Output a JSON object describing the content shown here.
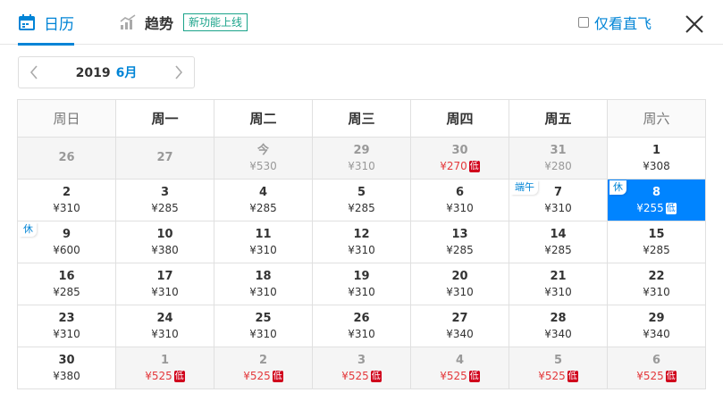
{
  "tabs": {
    "calendar": "日历",
    "trend": "趋势",
    "new_badge": "新功能上线"
  },
  "direct_only_label": "仅看直飞",
  "month_nav": {
    "year": "2019",
    "month": "6月"
  },
  "weekdays": [
    "周日",
    "周一",
    "周二",
    "周三",
    "周四",
    "周五",
    "周六"
  ],
  "low_tag": "低",
  "colors": {
    "accent": "#0084d6",
    "selected": "#0084ff",
    "low_price": "#e4393c",
    "new_badge": "#1aa38a"
  },
  "weeks": [
    [
      {
        "day": "26",
        "price": "",
        "other": true
      },
      {
        "day": "27",
        "price": "",
        "other": true
      },
      {
        "day": "今",
        "price": "¥530",
        "other": true
      },
      {
        "day": "29",
        "price": "¥310",
        "other": true
      },
      {
        "day": "30",
        "price": "¥270",
        "other": true,
        "low": true
      },
      {
        "day": "31",
        "price": "¥280",
        "other": true
      },
      {
        "day": "1",
        "price": "¥308"
      }
    ],
    [
      {
        "day": "2",
        "price": "¥310"
      },
      {
        "day": "3",
        "price": "¥285"
      },
      {
        "day": "4",
        "price": "¥285"
      },
      {
        "day": "5",
        "price": "¥285"
      },
      {
        "day": "6",
        "price": "¥310"
      },
      {
        "day": "7",
        "price": "¥310",
        "holiday": "端午"
      },
      {
        "day": "8",
        "price": "¥255",
        "holiday": "休",
        "low": true,
        "selected": true
      }
    ],
    [
      {
        "day": "9",
        "price": "¥600",
        "holiday": "休"
      },
      {
        "day": "10",
        "price": "¥380"
      },
      {
        "day": "11",
        "price": "¥310"
      },
      {
        "day": "12",
        "price": "¥310"
      },
      {
        "day": "13",
        "price": "¥285"
      },
      {
        "day": "14",
        "price": "¥285"
      },
      {
        "day": "15",
        "price": "¥285"
      }
    ],
    [
      {
        "day": "16",
        "price": "¥285"
      },
      {
        "day": "17",
        "price": "¥310"
      },
      {
        "day": "18",
        "price": "¥310"
      },
      {
        "day": "19",
        "price": "¥310"
      },
      {
        "day": "20",
        "price": "¥310"
      },
      {
        "day": "21",
        "price": "¥310"
      },
      {
        "day": "22",
        "price": "¥310"
      }
    ],
    [
      {
        "day": "23",
        "price": "¥310"
      },
      {
        "day": "24",
        "price": "¥310"
      },
      {
        "day": "25",
        "price": "¥310"
      },
      {
        "day": "26",
        "price": "¥310"
      },
      {
        "day": "27",
        "price": "¥340"
      },
      {
        "day": "28",
        "price": "¥340"
      },
      {
        "day": "29",
        "price": "¥340"
      }
    ],
    [
      {
        "day": "30",
        "price": "¥380"
      },
      {
        "day": "1",
        "price": "¥525",
        "other": true,
        "low": true
      },
      {
        "day": "2",
        "price": "¥525",
        "other": true,
        "low": true
      },
      {
        "day": "3",
        "price": "¥525",
        "other": true,
        "low": true
      },
      {
        "day": "4",
        "price": "¥525",
        "other": true,
        "low": true
      },
      {
        "day": "5",
        "price": "¥525",
        "other": true,
        "low": true
      },
      {
        "day": "6",
        "price": "¥525",
        "other": true,
        "low": true
      }
    ]
  ]
}
